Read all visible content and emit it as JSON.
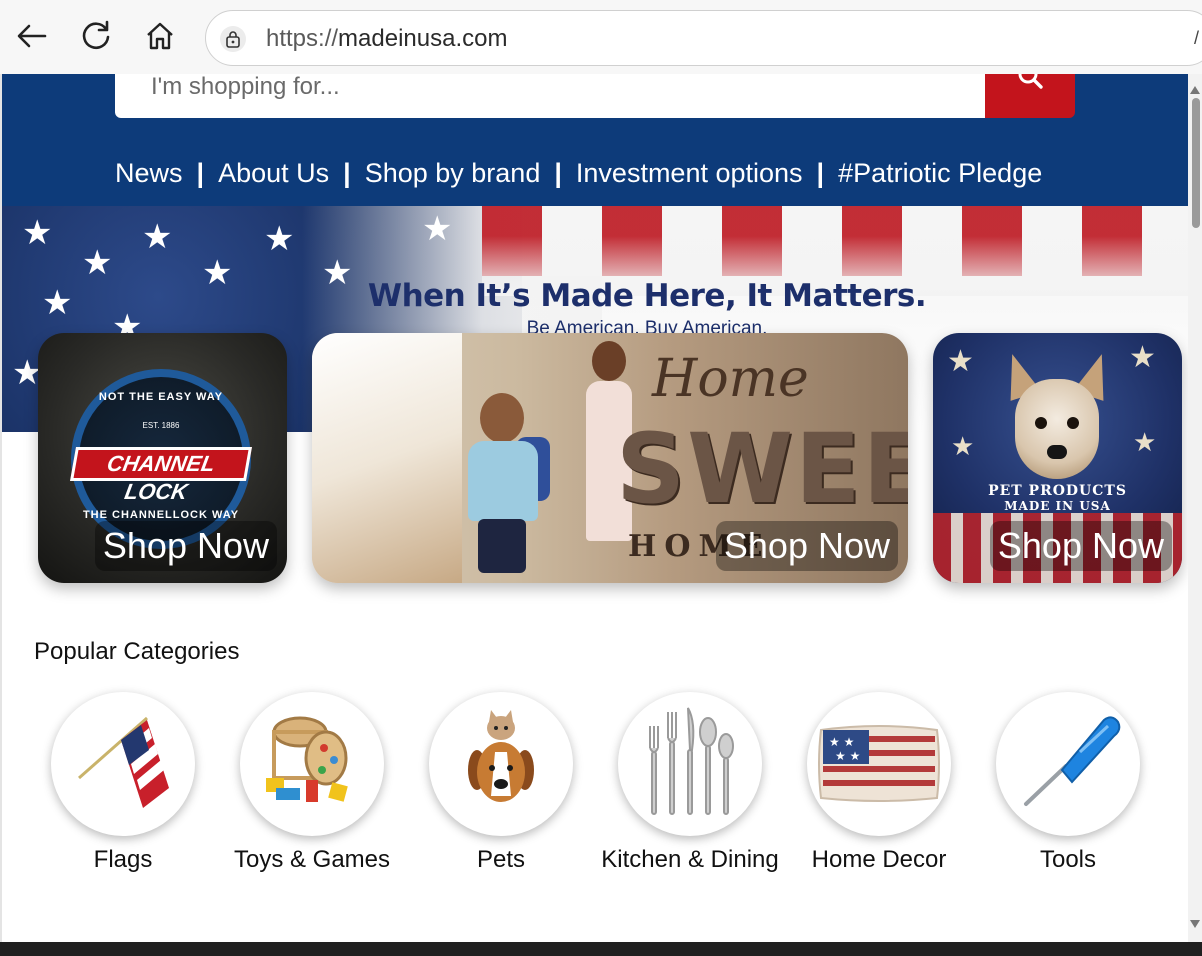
{
  "browser": {
    "url_scheme": "https://",
    "url_host": "madeinusa.com"
  },
  "header": {
    "search_placeholder": "I'm shopping for...",
    "nav": [
      "News",
      "About Us",
      "Shop by brand",
      "Investment options",
      "#Patriotic Pledge"
    ],
    "nav_separator": "|"
  },
  "hero": {
    "headline": "When It’s Made Here, It Matters.",
    "subline": "Be American. Buy American."
  },
  "promos": [
    {
      "logo_top": "NOT THE EASY WAY",
      "logo_est": "EST. 1886",
      "logo_name": "CHANNEL LOCK",
      "logo_bottom": "THE CHANNELLOCK WAY",
      "cta": "Shop Now"
    },
    {
      "title_script": "Home",
      "title_big": "SWEET",
      "title_bottom": "HOME",
      "cta": "Shop Now"
    },
    {
      "label_line1": "PET PRODUCTS",
      "label_line2": "MADE IN USA",
      "cta": "Shop Now"
    }
  ],
  "categories_title": "Popular Categories",
  "categories": [
    {
      "label": "Flags",
      "icon": "flag-icon"
    },
    {
      "label": "Toys & Games",
      "icon": "toy-icon"
    },
    {
      "label": "Pets",
      "icon": "pet-icon"
    },
    {
      "label": "Kitchen & Dining",
      "icon": "cutlery-icon"
    },
    {
      "label": "Home Decor",
      "icon": "pillow-icon"
    },
    {
      "label": "Tools",
      "icon": "screwdriver-icon"
    }
  ],
  "colors": {
    "header_blue": "#0d3b7a",
    "search_red": "#c3141c",
    "headline_navy": "#1d2f6b"
  }
}
